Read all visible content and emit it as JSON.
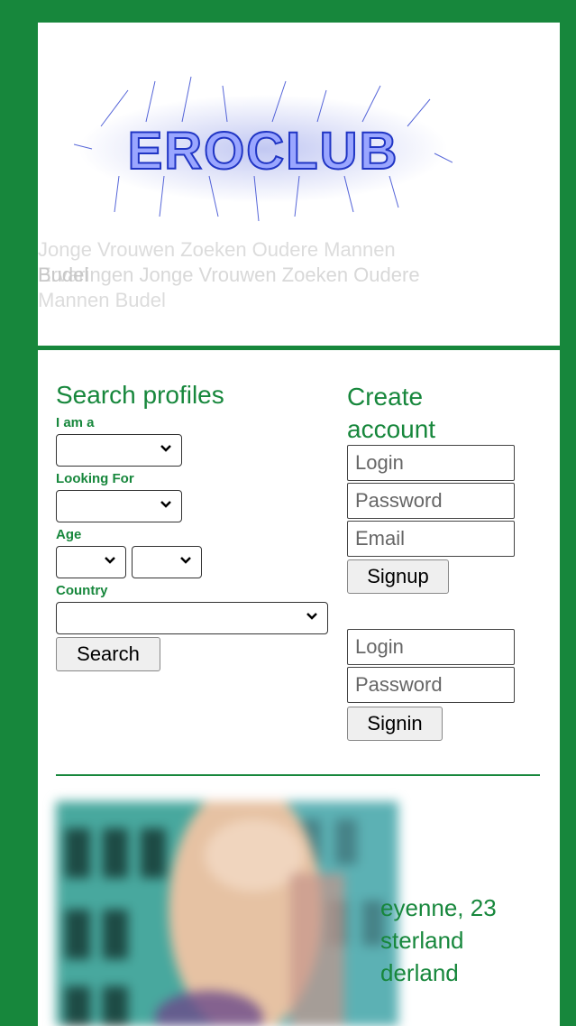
{
  "header": {
    "logo_text": "EROCLUB",
    "tagline_line1": "Jonge Vrouwen Zoeken Oudere Mannen",
    "tagline_overlay": "Budel",
    "tagline_line2": "Ervaringen Jonge Vrouwen Zoeken Oudere",
    "tagline_line3": "Mannen Budel"
  },
  "search": {
    "title": "Search profiles",
    "i_am_label": "I am a",
    "looking_for_label": "Looking For",
    "age_label": "Age",
    "country_label": "Country",
    "button": "Search"
  },
  "create": {
    "title": "Create account",
    "login_placeholder": "Login",
    "password_placeholder": "Password",
    "email_placeholder": "Email",
    "signup_button": "Signup"
  },
  "signin": {
    "login_placeholder": "Login",
    "password_placeholder": "Password",
    "signin_button": "Signin"
  },
  "profile": {
    "line1": "eyenne, 23",
    "line2": "sterland",
    "line3": "derland"
  },
  "colors": {
    "brand_green": "#17873c"
  }
}
